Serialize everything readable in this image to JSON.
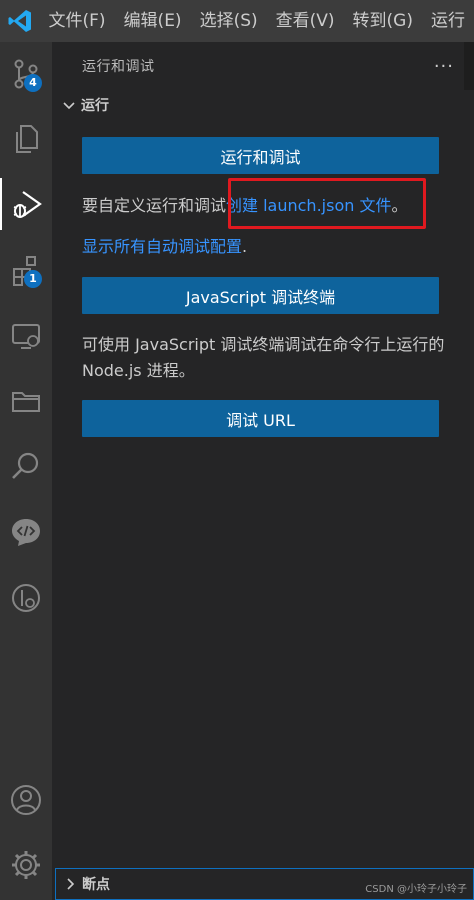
{
  "menubar": {
    "items": [
      "文件(F)",
      "编辑(E)",
      "选择(S)",
      "查看(V)",
      "转到(G)",
      "运行"
    ]
  },
  "activitybar": {
    "source_control_badge": "4",
    "extensions_badge": "1"
  },
  "sidebar": {
    "title": "运行和调试",
    "more": "···",
    "section_title": "运行",
    "run_debug_button": "运行和调试",
    "customize_text": "要自定义运行和调试",
    "create_link": "创建 launch.json 文件",
    "customize_suffix": "。",
    "show_configs_link": "显示所有自动调试配置",
    "show_configs_suffix": ".",
    "js_terminal_button": "JavaScript 调试终端",
    "js_terminal_desc": "可使用 JavaScript 调试终端调试在命令行上运行的 Node.js 进程。",
    "debug_url_button": "调试 URL",
    "breakpoints_title": "断点"
  },
  "watermark": "CSDN @小玲子小玲子",
  "colors": {
    "accent": "#0e639c",
    "link": "#3794ff",
    "highlight": "#e0191f",
    "badge": "#0e70c0"
  }
}
